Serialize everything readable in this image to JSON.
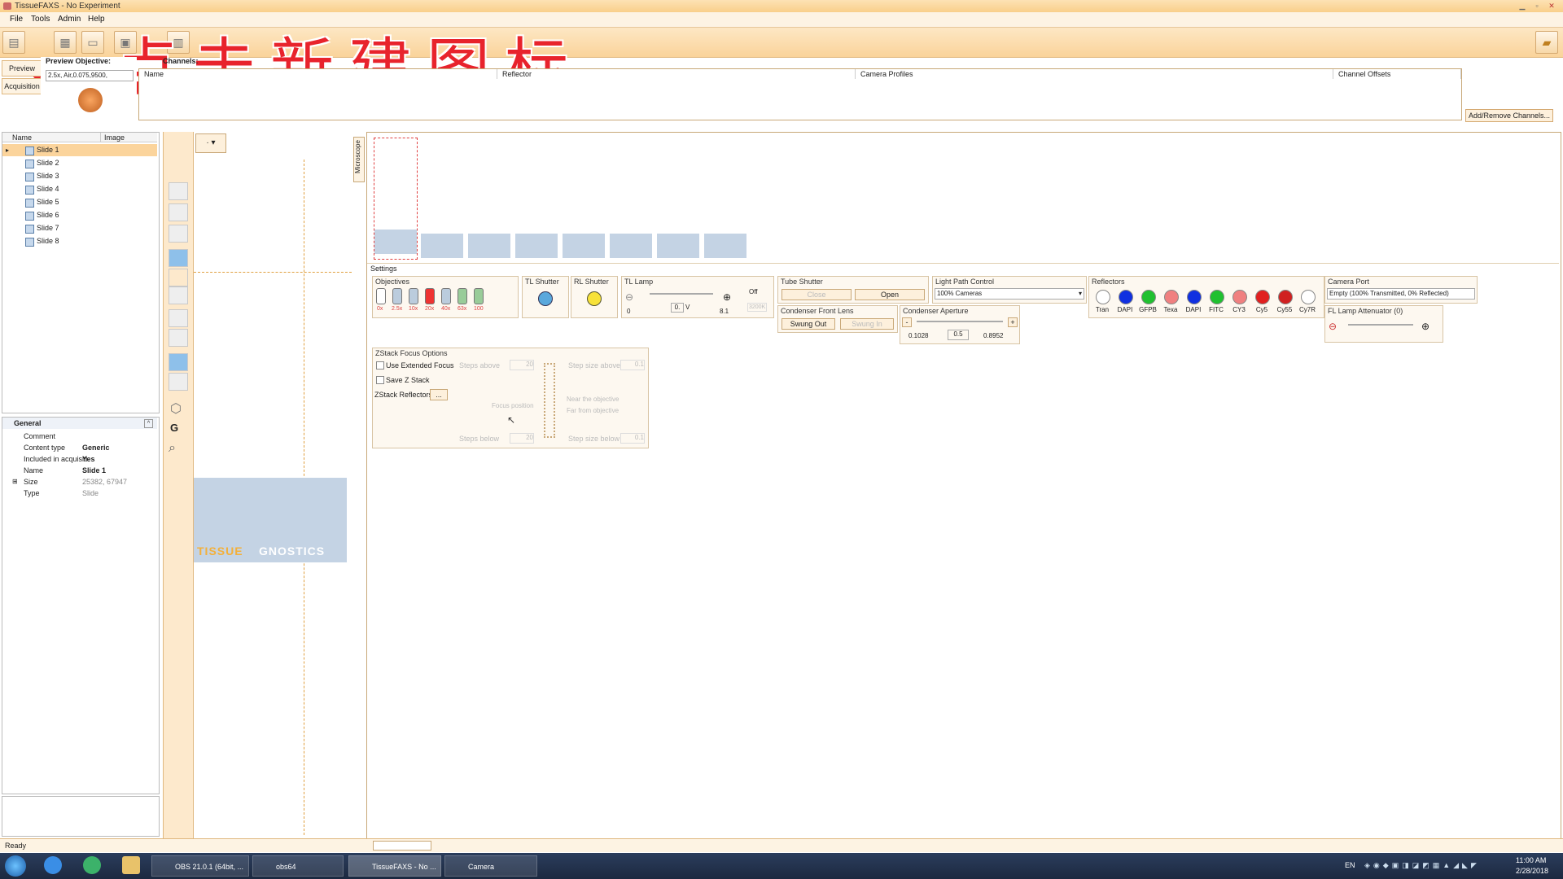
{
  "window": {
    "title": "TissueFAXS - No Experiment"
  },
  "menu": [
    "File",
    "Tools",
    "Admin",
    "Help"
  ],
  "annotation": {
    "text": "点击新建图标",
    "arrow": "⟵"
  },
  "left_tabs": [
    "Preview",
    "Acquisition"
  ],
  "preview": {
    "objective_label": "Preview Objective:",
    "objective_value": "2.5x, Air,0.075,9500,",
    "channels_label": "Channels:"
  },
  "channels_table": {
    "headers": [
      "Name",
      "Reflector",
      "Camera Profiles",
      "Channel Offsets"
    ]
  },
  "add_remove_button": "Add/Remove Channels...",
  "tree": {
    "headers": [
      "Name",
      "Image"
    ],
    "slides": [
      "Slide 1",
      "Slide 2",
      "Slide 3",
      "Slide 4",
      "Slide 5",
      "Slide 6",
      "Slide 7",
      "Slide 8"
    ]
  },
  "properties": {
    "section": "General",
    "rows": [
      {
        "key": "Comment",
        "value": ""
      },
      {
        "key": "Content type",
        "value": "Generic"
      },
      {
        "key": "Included in acquisiti",
        "value": "Yes"
      },
      {
        "key": "Name",
        "value": "Slide 1"
      },
      {
        "key": "Size",
        "value": "25382, 67947"
      },
      {
        "key": "Type",
        "value": "Slide"
      }
    ]
  },
  "slideview": {
    "dropdown": "·",
    "logo_left": "TISSUE",
    "logo_right": "GNOSTICS"
  },
  "microscope_tab": "Microscope",
  "settings": {
    "title": "Settings",
    "objectives": {
      "title": "Objectives",
      "labels": [
        "0x",
        "2.5x",
        "10x",
        "20x",
        "40x",
        "63x",
        "100"
      ]
    },
    "tl_shutter": {
      "title": "TL Shutter"
    },
    "rl_shutter": {
      "title": "RL Shutter"
    },
    "tl_lamp": {
      "title": "TL Lamp",
      "min": "0",
      "value": "0.",
      "unit": "V",
      "max": "8.1",
      "off": "Off",
      "k": "3200K"
    },
    "tube_shutter": {
      "title": "Tube Shutter",
      "close": "Close",
      "open": "Open"
    },
    "light_path": {
      "title": "Light Path Control",
      "value": "100% Cameras"
    },
    "condenser_front": {
      "title": "Condenser Front Lens",
      "swung_out": "Swung Out",
      "swung_in": "Swung In"
    },
    "condenser_aperture": {
      "title": "Condenser Aperture",
      "min": "0.1028",
      "value": "0.5",
      "max": "0.8952",
      "minus": "-",
      "plus": "+"
    },
    "reflectors": {
      "title": "Reflectors",
      "items": [
        {
          "label": "Tran",
          "color": "#ffffff"
        },
        {
          "label": "DAPI",
          "color": "#1030e0"
        },
        {
          "label": "GFPB",
          "color": "#20c030"
        },
        {
          "label": "Texa",
          "color": "#f08080"
        },
        {
          "label": "DAPI",
          "color": "#1030e0"
        },
        {
          "label": "FITC",
          "color": "#20c030"
        },
        {
          "label": "CY3",
          "color": "#f08080"
        },
        {
          "label": "Cy5",
          "color": "#e02020"
        },
        {
          "label": "Cy55",
          "color": "#d02020"
        },
        {
          "label": "Cy7R",
          "color": "#ffffff"
        }
      ]
    },
    "camera_port": {
      "title": "Camera Port",
      "value": "Empty (100% Transmitted, 0% Reflected)"
    },
    "fl_lamp": {
      "title": "FL Lamp Attenuator (0)"
    },
    "zstack": {
      "title": "ZStack Focus Options",
      "extended": "Use Extended Focus",
      "save": "Save Z Stack",
      "reflectors": "ZStack Reflectors",
      "reflectors_btn": "...",
      "steps_above": "Steps above",
      "steps_above_val": "20",
      "step_size_above": "Step size above",
      "step_size_above_val": "0.1",
      "focus_position": "Focus position",
      "near": "Near the objective",
      "far": "Far from objective",
      "steps_below": "Steps below",
      "steps_below_val": "20",
      "step_size_below": "Step size below",
      "step_size_below_val": "0.1"
    }
  },
  "status": {
    "text": "Ready"
  },
  "taskbar": {
    "items": [
      "OBS 21.0.1 (64bit, ...",
      "obs64",
      "TissueFAXS - No ...",
      "Camera"
    ],
    "lang": "EN",
    "time": "11:00 AM",
    "date": "2/28/2018"
  },
  "colors": {
    "accent": "#fad39a",
    "annotation": "#e8232c",
    "thumb": "#c4d3e4"
  }
}
